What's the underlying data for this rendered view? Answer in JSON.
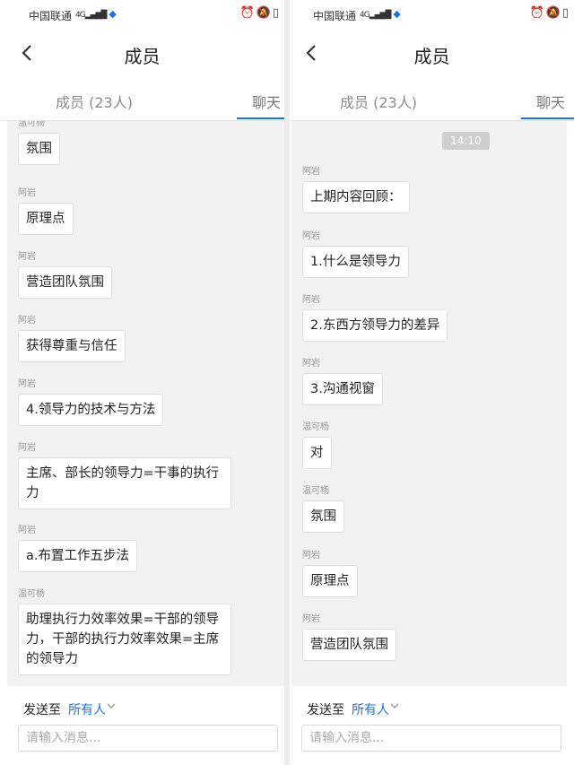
{
  "status": {
    "carrier": "中国联通",
    "signal": "4G ᵢᵢₗₗ",
    "right_icons": [
      "alarm-icon",
      "mute-bell-icon",
      "battery-icon"
    ]
  },
  "header": {
    "title": "成员"
  },
  "tabs": {
    "members": "成员 (23人)",
    "chat": "聊天"
  },
  "footer": {
    "send_to_label": "发送至",
    "recipient": "所有人",
    "input_placeholder": "请输入消息..."
  },
  "left_panel": {
    "messages": [
      {
        "sender": "温可杨",
        "text": "氛围"
      },
      {
        "sender": "阿岩",
        "text": "原理点"
      },
      {
        "sender": "阿岩",
        "text": "营造团队氛围"
      },
      {
        "sender": "阿岩",
        "text": "获得尊重与信任"
      },
      {
        "sender": "阿岩",
        "text": "4.领导力的技术与方法"
      },
      {
        "sender": "阿岩",
        "text": "主席、部长的领导力=干事的执行力"
      },
      {
        "sender": "阿岩",
        "text": "a.布置工作五步法"
      },
      {
        "sender": "温可杨",
        "text": "助理执行力效率效果=干部的领导力，干部的执行力效率效果=主席的领导力"
      }
    ]
  },
  "right_panel": {
    "time": "14:10",
    "messages": [
      {
        "sender": "阿岩",
        "text": "上期内容回顾："
      },
      {
        "sender": "阿岩",
        "text": "1.什么是领导力"
      },
      {
        "sender": "阿岩",
        "text": "2.东西方领导力的差异"
      },
      {
        "sender": "阿岩",
        "text": "3.沟通视窗"
      },
      {
        "sender": "温可杨",
        "text": "对"
      },
      {
        "sender": "温可杨",
        "text": "氛围"
      },
      {
        "sender": "阿岩",
        "text": "原理点"
      },
      {
        "sender": "阿岩",
        "text": "营造团队氛围"
      }
    ]
  },
  "colors": {
    "accent": "#1e73d8",
    "chat_bg": "#f2f2f2",
    "time_badge": "#cfcfcf"
  }
}
